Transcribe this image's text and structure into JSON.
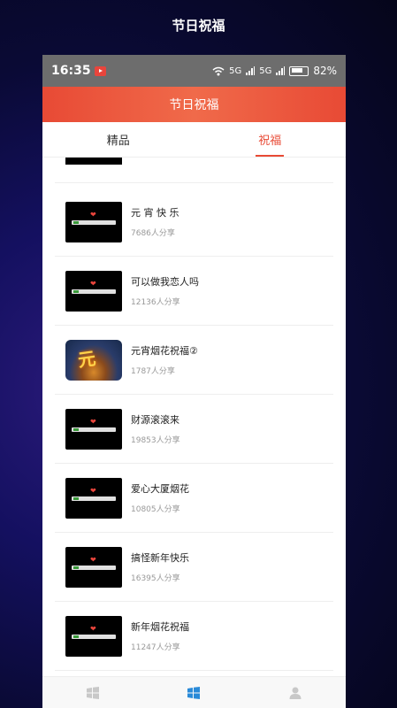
{
  "page_title": "节日祝福",
  "status": {
    "time": "16:35",
    "battery": "82%",
    "net1": "5G",
    "net2": "5G"
  },
  "app": {
    "title": "节日祝福"
  },
  "tabs": [
    {
      "label": "精品",
      "active": false
    },
    {
      "label": "祝福",
      "active": true
    }
  ],
  "items": [
    {
      "title": "元 宵 快 乐",
      "shares": "7686人分享",
      "thumb": "video"
    },
    {
      "title": "可以做我恋人吗",
      "shares": "12136人分享",
      "thumb": "video"
    },
    {
      "title": "元宵烟花祝福②",
      "shares": "1787人分享",
      "thumb": "photo"
    },
    {
      "title": "财源滚滚来",
      "shares": "19853人分享",
      "thumb": "video"
    },
    {
      "title": "爱心大厦烟花",
      "shares": "10805人分享",
      "thumb": "video"
    },
    {
      "title": "搞怪新年快乐",
      "shares": "16395人分享",
      "thumb": "video"
    },
    {
      "title": "新年烟花祝福",
      "shares": "11247人分享",
      "thumb": "video"
    }
  ],
  "icons": {
    "statusbar": [
      "record-icon",
      "wifi-icon",
      "signal-icon",
      "signal-icon",
      "battery-icon"
    ],
    "bottom_nav": [
      "windows-icon",
      "windows-icon",
      "user-icon"
    ]
  },
  "colors": {
    "accent": "#e84a35",
    "active_nav": "#2a8ad8",
    "inactive_nav": "#c8c8c8"
  }
}
